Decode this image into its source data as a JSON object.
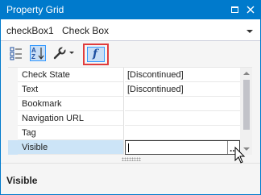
{
  "window": {
    "title": "Property Grid"
  },
  "selector": {
    "name": "checkBox1",
    "type": "Check Box"
  },
  "toolbar": {
    "buttons": [
      {
        "icon": "categorized-icon",
        "active": false
      },
      {
        "icon": "alphabetical-sort-icon",
        "active": true
      },
      {
        "icon": "wrench-icon",
        "active": false
      },
      {
        "icon": "function-icon",
        "active": true,
        "glyph": "f"
      }
    ]
  },
  "grid": {
    "rows": [
      {
        "name": "Check State",
        "value": "[Discontinued]"
      },
      {
        "name": "Text",
        "value": "[Discontinued]"
      },
      {
        "name": "Bookmark",
        "value": ""
      },
      {
        "name": "Navigation URL",
        "value": ""
      },
      {
        "name": "Tag",
        "value": ""
      },
      {
        "name": "Visible",
        "value": "",
        "selected": true,
        "ellipsis": "..."
      }
    ]
  },
  "description": {
    "title": "Visible"
  },
  "colors": {
    "accent": "#007acc",
    "highlight": "#e03c3c",
    "selection": "#cce4f7"
  }
}
